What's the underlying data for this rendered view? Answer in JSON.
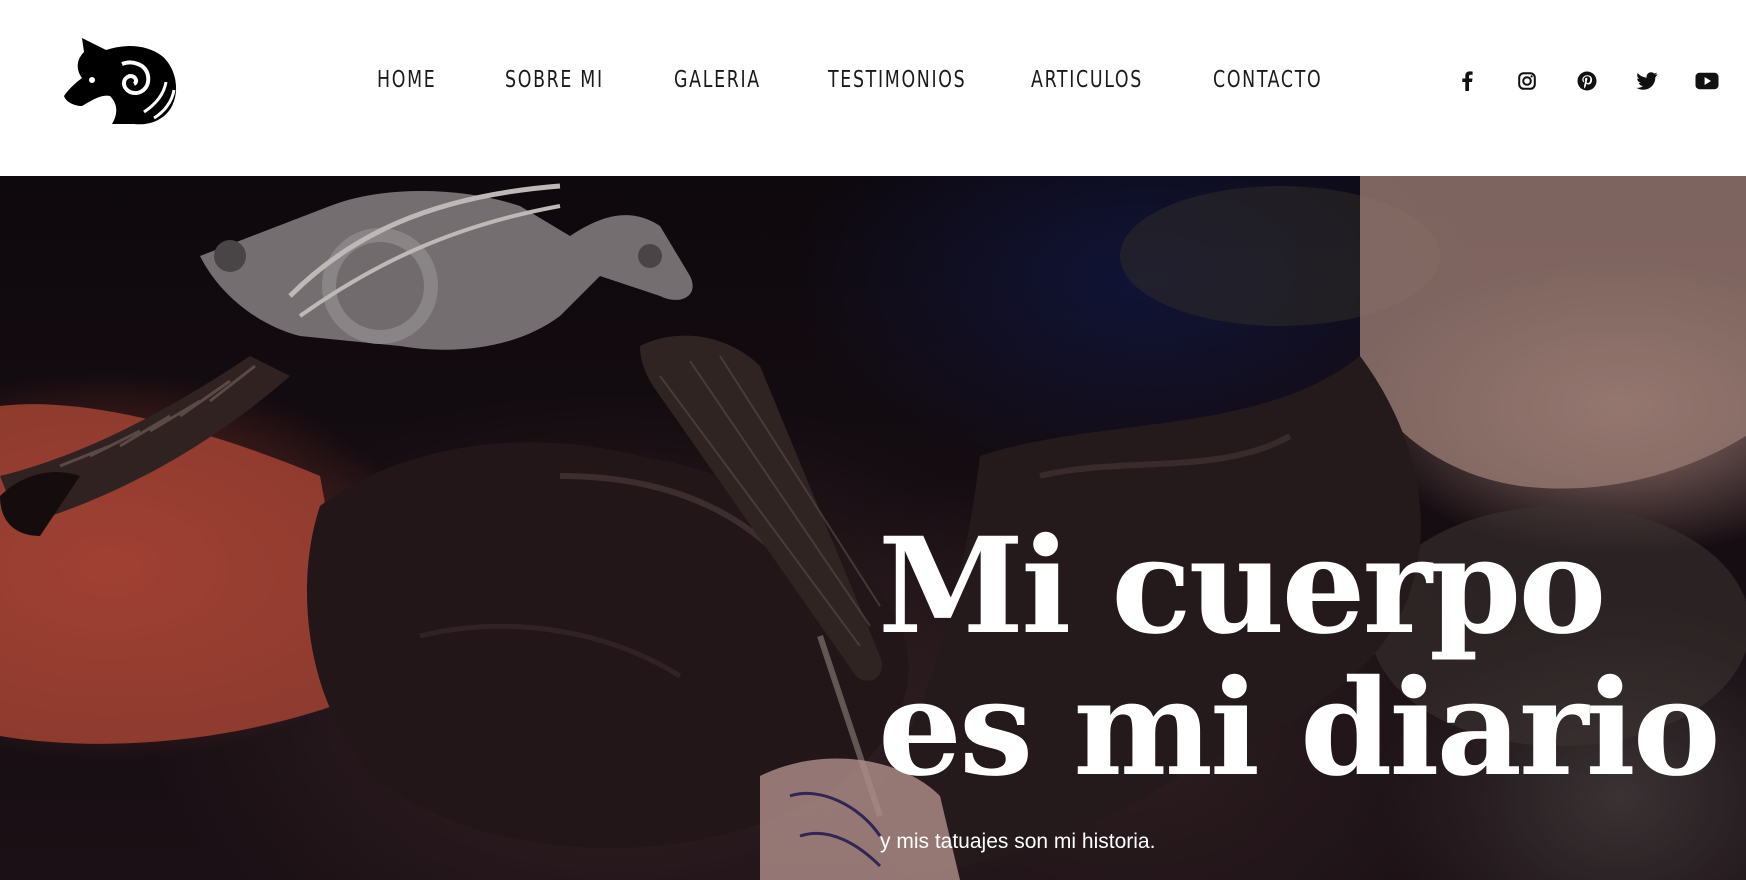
{
  "nav": {
    "items": [
      {
        "label": "HOME"
      },
      {
        "label": "SOBRE MI"
      },
      {
        "label": "GALERIA"
      },
      {
        "label": "TESTIMONIOS"
      },
      {
        "label": "ARTICULOS"
      },
      {
        "label": "CONTACTO"
      }
    ]
  },
  "social": [
    "facebook-icon",
    "instagram-icon",
    "pinterest-icon",
    "twitter-icon",
    "youtube-icon"
  ],
  "hero": {
    "title_line1": "Mi cuerpo",
    "title_line2": "es mi diario",
    "subtitle": "y mis tatuajes son mi historia."
  },
  "colors": {
    "nav_text": "#1a1a1a",
    "hero_text": "#ffffff",
    "header_bg": "#ffffff"
  }
}
